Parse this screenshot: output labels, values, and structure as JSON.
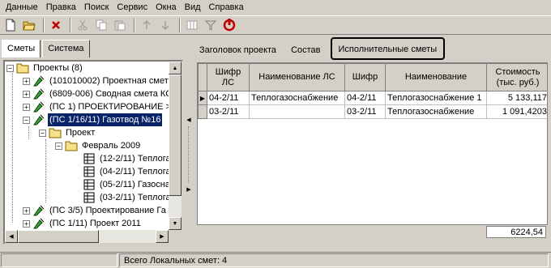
{
  "menu": [
    "Данные",
    "Правка",
    "Поиск",
    "Сервис",
    "Окна",
    "Вид",
    "Справка"
  ],
  "toolbar": {
    "icons": [
      "new-document-icon",
      "open-folder-icon",
      "delete-icon",
      "cut-icon",
      "copy-icon",
      "paste-icon",
      "arrow-up-icon",
      "arrow-down-icon",
      "column-chooser-icon",
      "filter-icon",
      "refresh-icon"
    ]
  },
  "left_tabs": [
    "Сметы",
    "Система"
  ],
  "tree": {
    "root": "Проекты (8)",
    "items": [
      "(101010002) Проектная смет",
      "(6809-006) Сводная смета КС",
      "(ПС 1) ПРОЕКТИРОВАНИЕ >",
      "(ПС 1/16/11) Газотвод №16",
      "Проект",
      "Февраль 2009",
      "(12-2/11) Теплога",
      "(04-2/11) Теплога",
      "(05-2/11) Газосна",
      "(03-2/11) Теплога",
      "(ПС 3/5) Проектирование Га",
      "(ПС 1/11) Проект 2011"
    ]
  },
  "right_tabs": [
    "Заголовок проекта",
    "Состав",
    "Исполнительные сметы"
  ],
  "grid": {
    "columns": [
      "Шифр ЛС",
      "Наименование ЛС",
      "Шифр",
      "Наименование",
      "Стоимость (тыс. руб.)"
    ],
    "rows": [
      {
        "indicator": "▶",
        "cells": [
          "04-2/11",
          "Теплогазоснабжение",
          "04-2/11",
          "Теплогазоснабжение 1",
          "5 133,117"
        ]
      },
      {
        "indicator": "",
        "cells": [
          "03-2/11",
          "",
          "03-2/11",
          "Теплогазоснабжение",
          "1 091,4203"
        ]
      }
    ],
    "total": "6224,54"
  },
  "status": {
    "text": "Всего Локальных смет: 4"
  }
}
